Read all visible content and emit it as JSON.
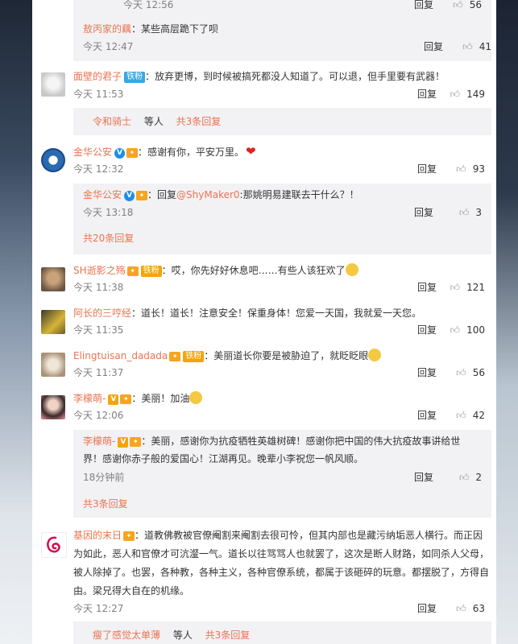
{
  "c0": {
    "time": "今天 12:56",
    "reply": "回复",
    "likes": "56"
  },
  "c0sub": {
    "name": "敖丙家的藕",
    "text": "：某些高层跪下了呗",
    "time": "今天 12:47",
    "reply": "回复",
    "likes": "41"
  },
  "c1": {
    "name": "面壁的君子",
    "badge": "铁粉",
    "text": "：放弃更博，到时候被搞死都没人知道了。可以退，但手里要有武器！",
    "time": "今天 11:53",
    "reply": "回复",
    "likes": "149"
  },
  "c1more": {
    "user": "令和骑士",
    "mid": " 等人 ",
    "count": "共3条回复"
  },
  "c2": {
    "name": "金华公安",
    "text": "：感谢有你，平安万里。",
    "time": "今天 12:32",
    "reply": "回复",
    "likes": "93"
  },
  "c2sub": {
    "name": "金华公安",
    "text1": "：回复",
    "mention": "@ShyMaker0",
    "text2": ":那姚明易建联去干什么？！",
    "time": "今天 13:18",
    "reply": "回复",
    "likes": "3"
  },
  "c2more": {
    "count": "共20条回复"
  },
  "c3": {
    "name": "SH逝影之殇",
    "badge": "铁粉",
    "text": "：哎，你先好好休息吧……有些人该狂欢了",
    "time": "今天 11:38",
    "reply": "回复",
    "likes": "121"
  },
  "c4": {
    "name": "阿长的三哼经",
    "text": "：道长！道长！注意安全！保重身体！您爱一天国，我就爱一天您。",
    "time": "今天 11:35",
    "reply": "回复",
    "likes": "100"
  },
  "c5": {
    "name": "Elingtuisan_dadada",
    "badge": "铁粉",
    "text": "：美丽道长你要是被胁迫了，就眨眨眼",
    "time": "今天 11:37",
    "reply": "回复",
    "likes": "56"
  },
  "c6": {
    "name": "李檬萌-",
    "text": "：美丽！加油",
    "time": "今天 12:06",
    "reply": "回复",
    "likes": "42"
  },
  "c6sub": {
    "name": "李檬萌-",
    "text1": "：美丽，感谢你为抗疫牺牲英雄树碑！感谢你把中国的伟大抗疫故事讲给世",
    "text2": "界！感谢你赤子般的爱国心！江湖再见。晚辈小李祝您一帆风顺。",
    "time": "18分钟前",
    "reply": "回复",
    "likes": "2"
  },
  "c6more": {
    "count": "共3条回复"
  },
  "c7": {
    "name": "基因的末日",
    "line1": "：道教佛教被官僚阉割来阉割去很可怜，但其内部也是藏污纳垢恶人横行。而正因",
    "line2": "为如此，恶人和官僚才可沆瀣一气。道长以往骂骂人也就罢了，这次是断人财路，如同杀人父母，",
    "line3": "被人除掉了。也罢，各种教，各种主义，各种官僚系统，都属于该砸碎的玩意。都摆脱了，方得自",
    "line4": "由。梁兄得大自在的机缘。",
    "time": "今天 12:27",
    "reply": "回复",
    "likes": "63"
  },
  "c7more": {
    "user": "瘦了感觉太单薄",
    "mid": " 等人 ",
    "count": "共3条回复"
  },
  "colors": {
    "accent": "#eb7350",
    "vip_blue": "#1e8de6",
    "bg": "#f2f2f5"
  }
}
